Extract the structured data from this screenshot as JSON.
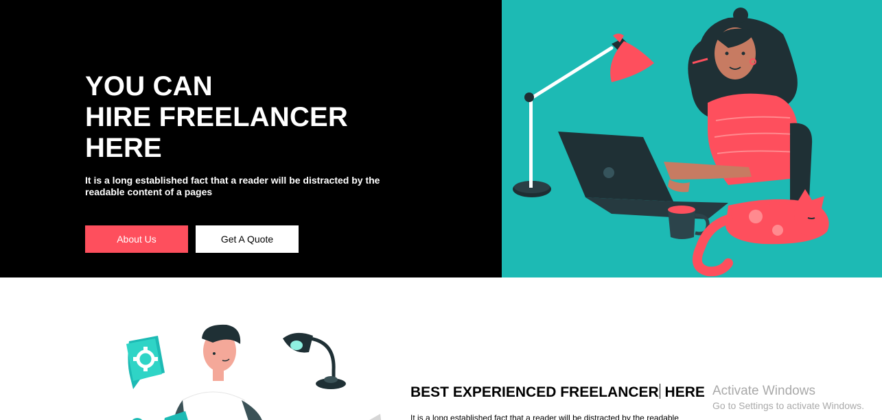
{
  "hero": {
    "title_lines": [
      "YOU CAN",
      "HIRE FREELANCER",
      "HERE"
    ],
    "description": "It is a long established fact that a reader will be distracted by the readable content of a pages",
    "buttons": {
      "about_label": "About Us",
      "quote_label": "Get A Quote"
    },
    "colors": {
      "left_bg": "#000000",
      "right_bg": "#1dbab4",
      "accent": "#fe4f5d"
    },
    "illustration_icon": "freelancer-at-laptop-illustration"
  },
  "section2": {
    "title_before_caret": "BEST EXPERIENCED FREELANCER",
    "title_after_caret": " HERE",
    "description": "It is a long established fact that a reader will be distracted by the readable",
    "illustration_icon": "developer-illustration"
  },
  "os_watermark": {
    "title": "Activate Windows",
    "subtitle": "Go to Settings to activate Windows."
  }
}
